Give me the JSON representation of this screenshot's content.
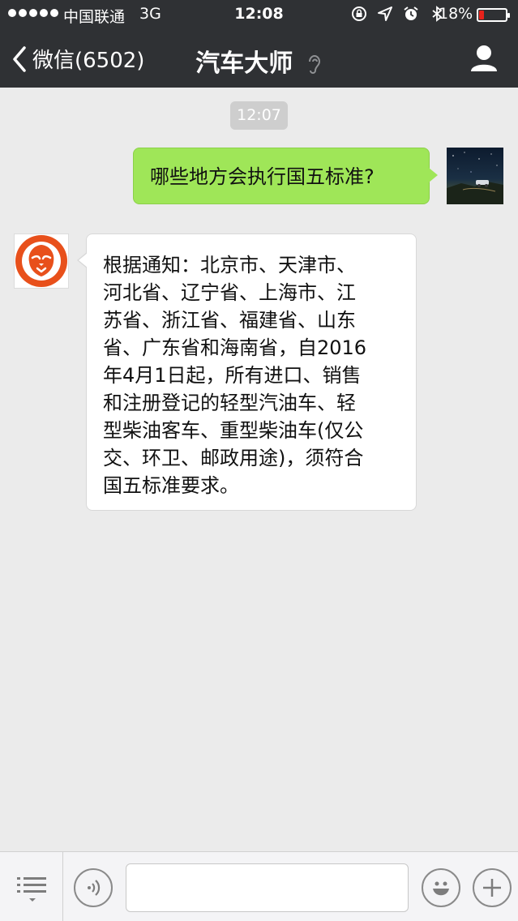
{
  "status_bar": {
    "carrier": "中国联通",
    "network": "3G",
    "time": "12:08",
    "battery_percent": "18%",
    "battery_level": 0.18,
    "icons": [
      "rotation-lock-icon",
      "location-icon",
      "alarm-icon",
      "bluetooth-icon"
    ]
  },
  "nav": {
    "back_label": "微信(6502)",
    "title": "汽车大师",
    "title_icon": "ear-icon",
    "profile_icon": "person-icon"
  },
  "chat": {
    "timestamp": "12:07",
    "messages": [
      {
        "sender": "me",
        "text": "哪些地方会执行国五标准?"
      },
      {
        "sender": "bot",
        "lines": [
          "根据通知：北京市、天津市、",
          "河北省、辽宁省、上海市、江",
          "苏省、浙江省、福建省、山东",
          "省、广东省和海南省，自2016",
          "年4月1日起，所有进口、销售",
          "和注册登记的轻型汽油车、轻",
          "型柴油客车、重型柴油车(仅公",
          "交、环卫、邮政用途)，须符合",
          "国五标准要求。"
        ]
      }
    ]
  },
  "toolbar": {
    "menu_icon": "menu-list-icon",
    "voice_icon": "voice-icon",
    "input_value": "",
    "emoji_icon": "emoji-icon",
    "plus_icon": "plus-icon"
  },
  "colors": {
    "nav_bg": "#2f3134",
    "chat_bg": "#ebebeb",
    "my_bubble": "#9fe658",
    "bot_bubble": "#ffffff",
    "battery_low": "#e8221b",
    "bot_avatar": "#e8501b"
  }
}
